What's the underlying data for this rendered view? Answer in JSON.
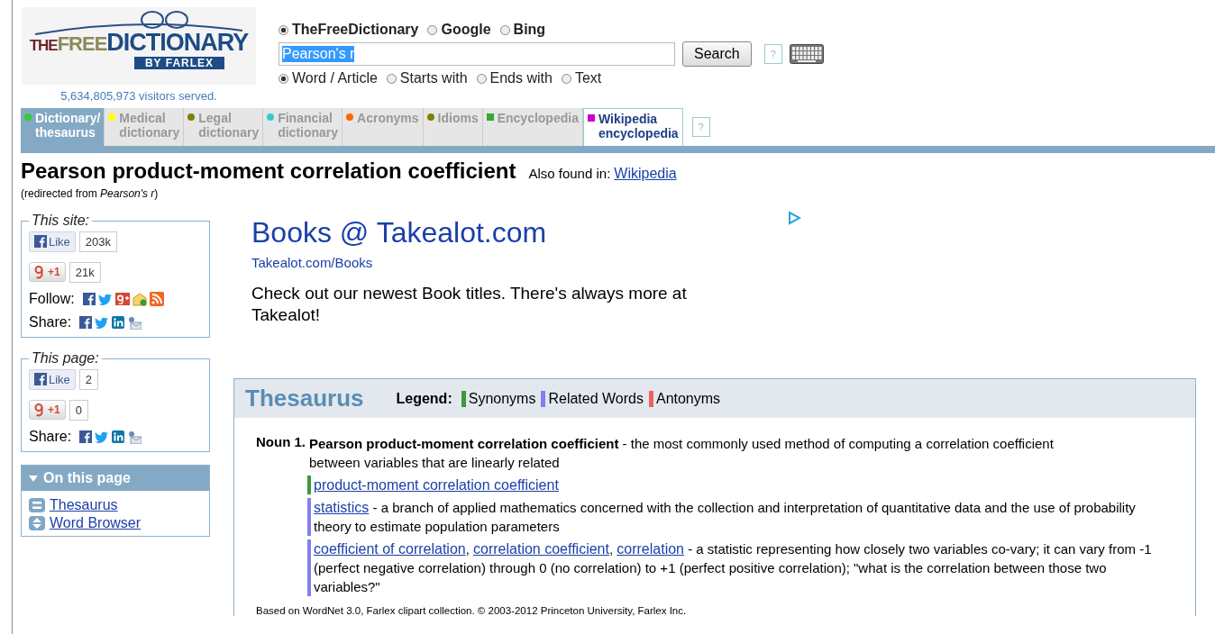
{
  "logo": {
    "word_1": "THE",
    "word_2": "FREE",
    "word_3": "DICTIONARY",
    "byline": "BY FARLEX"
  },
  "visitors": "5,634,805,973 visitors served.",
  "search": {
    "engines": [
      {
        "label": "TheFreeDictionary",
        "selected": true
      },
      {
        "label": "Google",
        "selected": false
      },
      {
        "label": "Bing",
        "selected": false
      }
    ],
    "value": "Pearson's r",
    "button": "Search",
    "help": "?",
    "modes": [
      {
        "label": "Word / Article",
        "selected": true
      },
      {
        "label": "Starts with",
        "selected": false
      },
      {
        "label": "Ends with",
        "selected": false
      },
      {
        "label": "Text",
        "selected": false
      }
    ]
  },
  "tabs": [
    {
      "lines": [
        "Dictionary/",
        "thesaurus"
      ],
      "color": "#33cc33",
      "kind": "dictionary",
      "selected": true
    },
    {
      "lines": [
        "Medical",
        "dictionary"
      ],
      "color": "#ffff00",
      "kind": "dictionary",
      "selected": false
    },
    {
      "lines": [
        "Legal",
        "dictionary"
      ],
      "color": "#808000",
      "kind": "dictionary",
      "selected": false
    },
    {
      "lines": [
        "Financial",
        "dictionary"
      ],
      "color": "#33cccc",
      "kind": "dictionary",
      "selected": false
    },
    {
      "lines": [
        "Acronyms"
      ],
      "color": "#ff6600",
      "kind": "dictionary",
      "selected": false
    },
    {
      "lines": [
        "Idioms"
      ],
      "color": "#808000",
      "kind": "dictionary",
      "selected": false
    },
    {
      "lines": [
        "Encyclopedia"
      ],
      "color": "#33aa33",
      "kind": "encyclopedia",
      "selected": false
    },
    {
      "lines": [
        "Wikipedia",
        "encyclopedia"
      ],
      "color": "#cc00cc",
      "kind": "external",
      "selected": false
    }
  ],
  "tabs_help": "?",
  "heading": {
    "title": "Pearson product-moment correlation coefficient",
    "also_label": "Also found in:",
    "also_link": "Wikipedia",
    "redirect": "(redirected from *Pearson's r*)"
  },
  "social_boxes": [
    {
      "title": "This site:",
      "like": "Like",
      "like_count": "203k",
      "plus": "+1",
      "plus_count": "21k",
      "rows": [
        {
          "kind": "follow",
          "label": "Follow:"
        },
        {
          "kind": "share",
          "label": "Share:"
        }
      ]
    },
    {
      "title": "This page:",
      "like": "Like",
      "like_count": "2",
      "plus": "+1",
      "plus_count": "0",
      "rows": [
        {
          "kind": "share",
          "label": "Share:"
        }
      ]
    }
  ],
  "on_this_page": {
    "title": "On this page",
    "links": [
      {
        "kind": "list",
        "label": "Thesaurus"
      },
      {
        "kind": "browser",
        "label": "Word Browser"
      }
    ]
  },
  "ad": {
    "title": "Books @ Takealot.com",
    "url": "Takealot.com/Books",
    "text": "Check out our newest Book titles. There's always more at Takealot!"
  },
  "thesaurus": {
    "title": "Thesaurus",
    "legend_label": "Legend:",
    "legend": [
      {
        "label": "Synonyms",
        "color": "#3a9a3a"
      },
      {
        "label": "Related Words",
        "color": "#8080f0"
      },
      {
        "label": "Antonyms",
        "color": "#f06060"
      }
    ],
    "sense": "Noun 1.",
    "definition": "**Pearson product-moment correlation coefficient** - the most commonly used method of computing a correlation coefficient between variables that are linearly related",
    "groups": [
      {
        "color": "#3a9a3a",
        "parts": [
          {
            "kind": "link",
            "text": "product-moment correlation coefficient"
          }
        ]
      },
      {
        "color": "#8080f0",
        "parts": [
          {
            "kind": "link",
            "text": "statistics"
          },
          {
            "kind": "text",
            "text": " - a branch of applied mathematics concerned with the collection and interpretation of quantitative data and the use of probability theory to estimate population parameters"
          }
        ]
      },
      {
        "color": "#8080f0",
        "parts": [
          {
            "kind": "link",
            "text": "coefficient of correlation"
          },
          {
            "kind": "text",
            "text": ", "
          },
          {
            "kind": "link",
            "text": "correlation coefficient"
          },
          {
            "kind": "text",
            "text": ", "
          },
          {
            "kind": "link",
            "text": "correlation"
          },
          {
            "kind": "text",
            "text": " - a statistic representing how closely two variables co-vary; it can vary from -1 (perfect negative correlation) through 0 (no correlation) to +1 (perfect positive correlation); \"what is the correlation between those two variables?\""
          }
        ]
      }
    ],
    "credit": "Based on WordNet 3.0, Farlex clipart collection. © 2003-2012 Princeton University, Farlex Inc."
  }
}
